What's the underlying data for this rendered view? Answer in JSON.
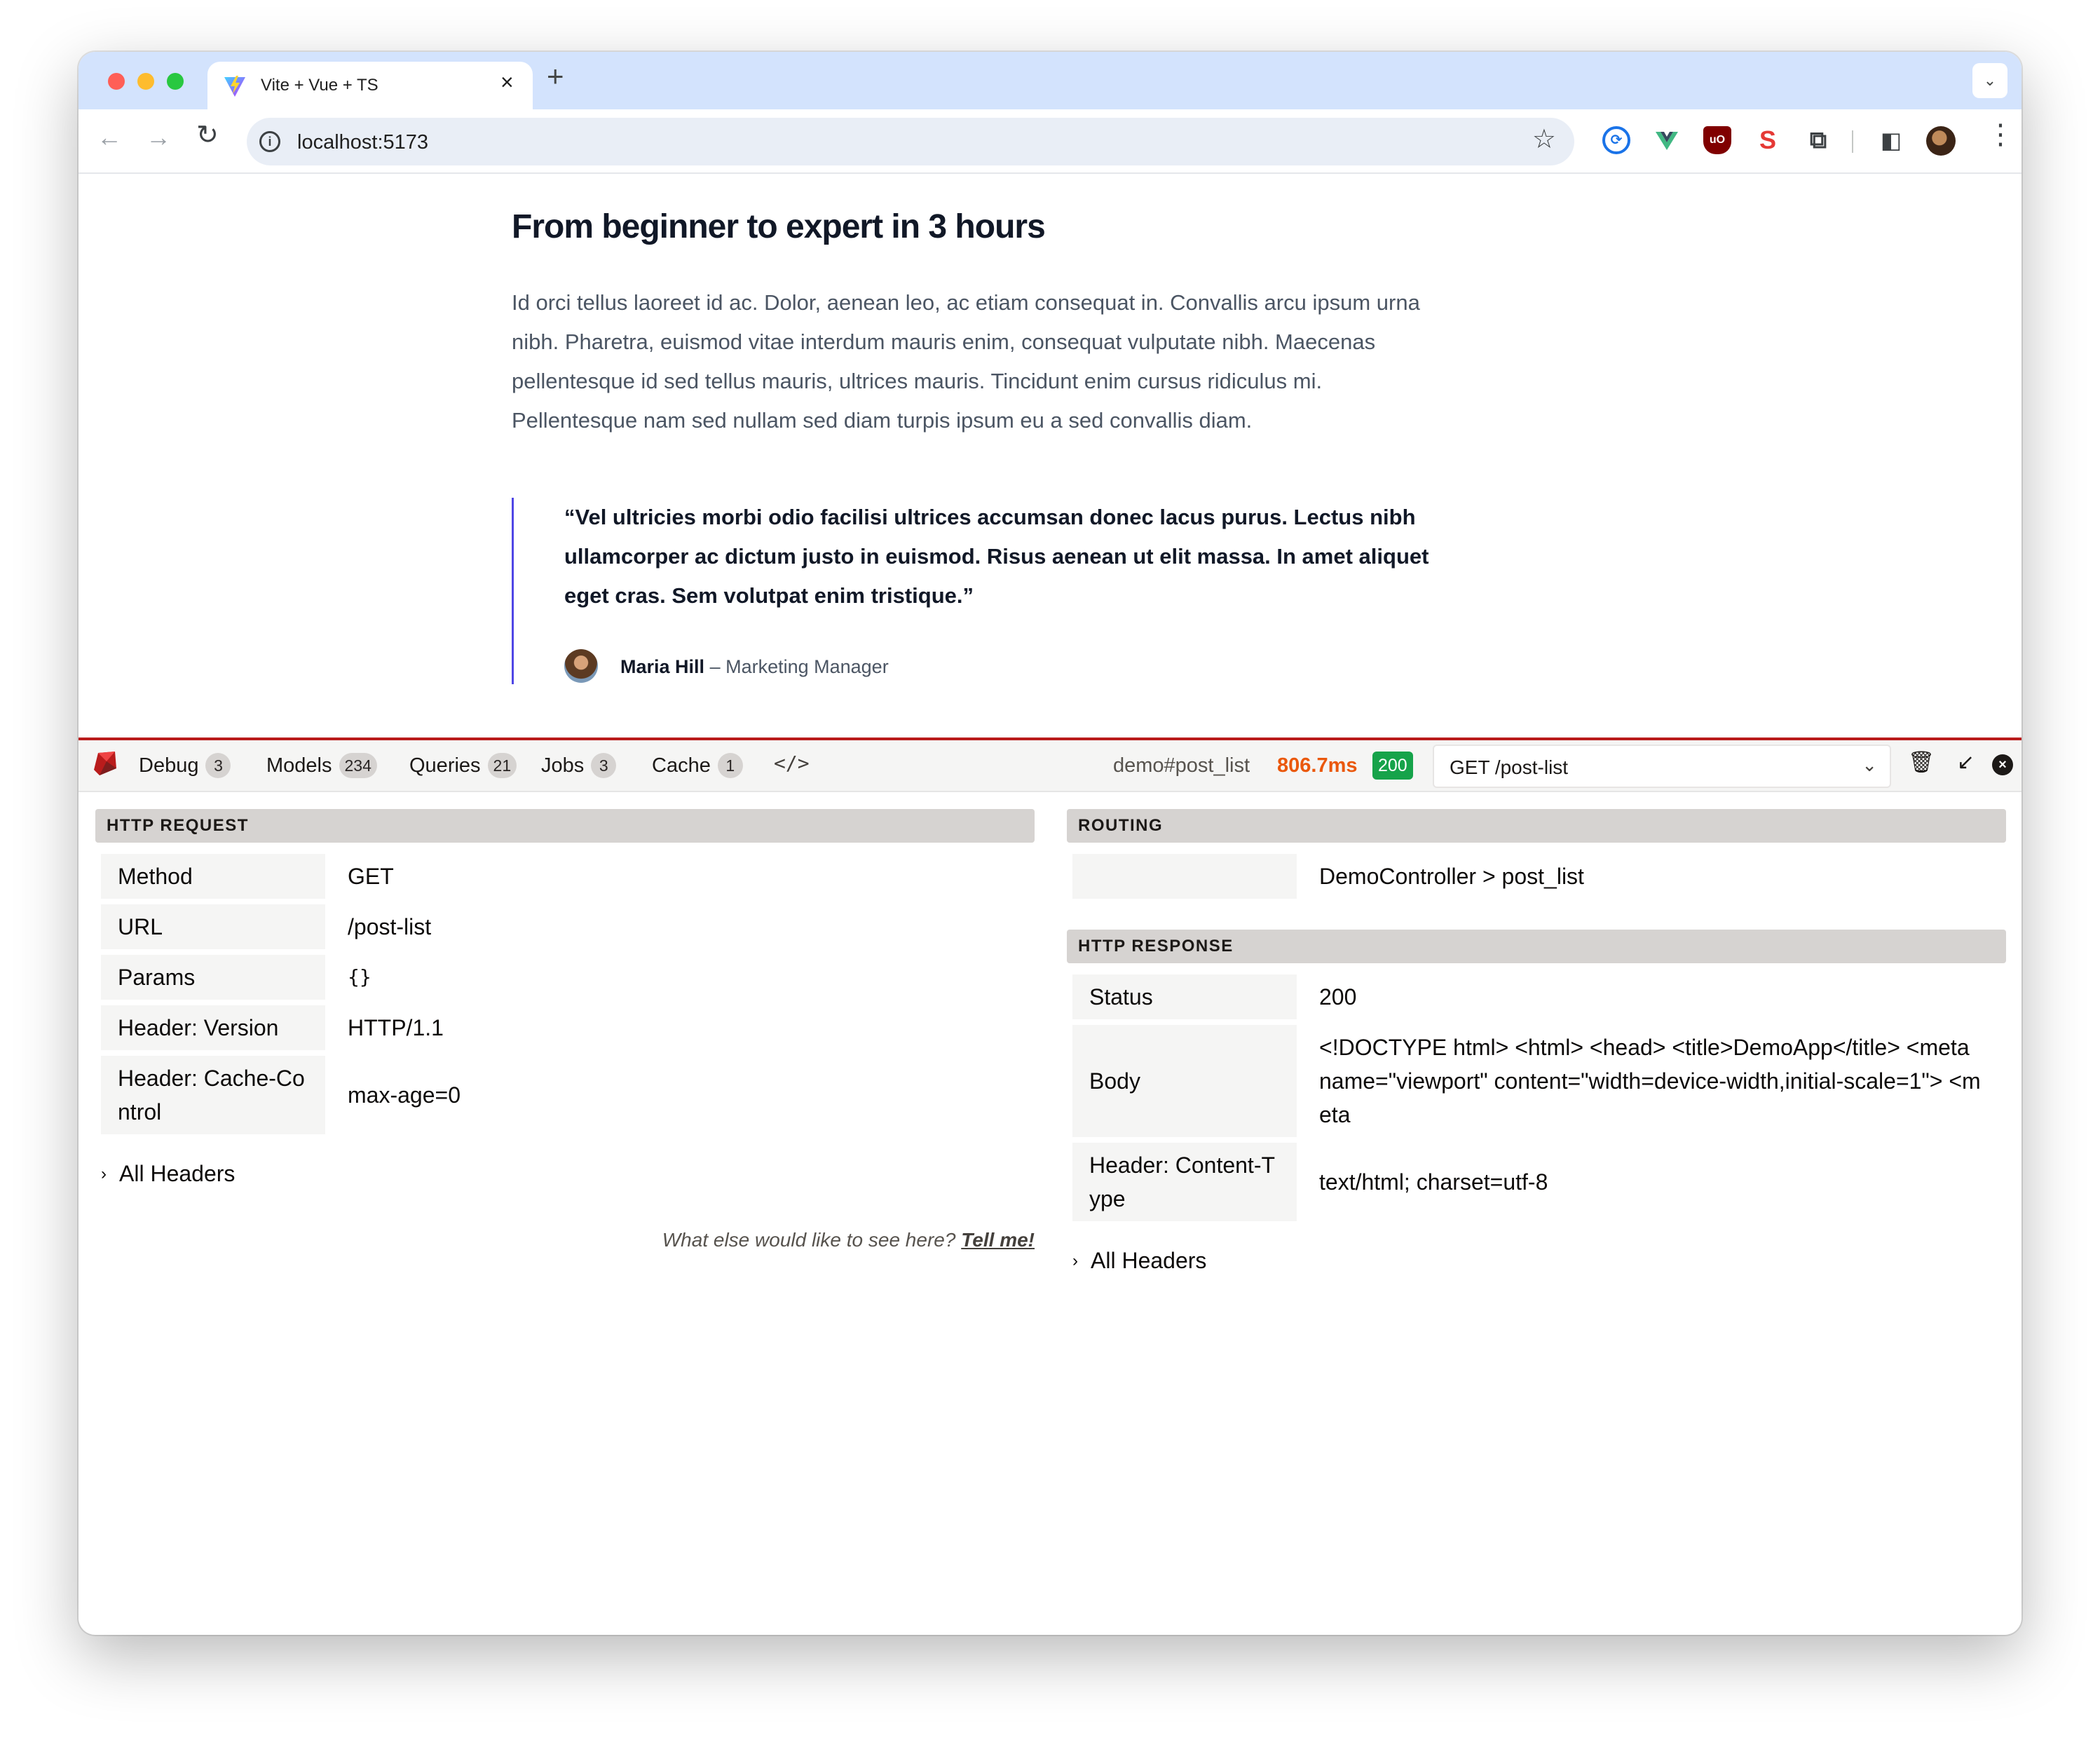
{
  "browser": {
    "tab_title": "Vite + Vue + TS",
    "tab_close": "×",
    "new_tab": "+",
    "tab_menu": "⌄",
    "url": "localhost:5173",
    "nav_back": "←",
    "nav_forward": "→",
    "nav_reload": "↻",
    "info": "i",
    "star": "☆",
    "menu": "⋮",
    "extensions": [
      "password-manager-icon",
      "vue-devtools-icon",
      "ublock-origin-icon",
      "seo-extension-icon",
      "extensions-puzzle-icon",
      "side-panel-icon"
    ]
  },
  "article": {
    "title": "From beginner to expert in 3 hours",
    "body": "Id orci tellus laoreet id ac. Dolor, aenean leo, ac etiam consequat in. Convallis arcu ipsum urna nibh. Pharetra, euismod vitae interdum mauris enim, consequat vulputate nibh. Maecenas pellentesque id sed tellus mauris, ultrices mauris. Tincidunt enim cursus ridiculus mi. Pellentesque nam sed nullam sed diam turpis ipsum eu a sed convallis diam.",
    "quote": "“Vel ultricies morbi odio facilisi ultrices accumsan donec lacus purus. Lectus nibh ullamcorper ac dictum justo in euismod. Risus aenean ut elit massa. In amet aliquet eget cras. Sem volutpat enim tristique.”",
    "author_name": "Maria Hill",
    "author_role": "– Marketing Manager"
  },
  "debugbar": {
    "tabs": [
      {
        "label": "Debug",
        "count": "3"
      },
      {
        "label": "Models",
        "count": "234"
      },
      {
        "label": "Queries",
        "count": "21"
      },
      {
        "label": "Jobs",
        "count": "3"
      },
      {
        "label": "Cache",
        "count": "1"
      }
    ],
    "code_icon": "</>",
    "route": "demo#post_list",
    "duration": "806.7ms",
    "status": "200",
    "request_select": "GET /post-list",
    "select_chevron": "⌄",
    "trash": "🗑",
    "minimize": "↙",
    "close": "×",
    "accent_color": "#b91c1c"
  },
  "http_request": {
    "heading": "HTTP REQUEST",
    "rows": [
      {
        "key": "Method",
        "value": "GET"
      },
      {
        "key": "URL",
        "value": "/post-list"
      },
      {
        "key": "Params",
        "value": "{}"
      },
      {
        "key": "Header: Version",
        "value": "HTTP/1.1"
      },
      {
        "key": "Header: Cache-Control",
        "value": "max-age=0"
      }
    ],
    "all_headers": "All Headers",
    "feedback_text": "What else would like to see here?",
    "feedback_link": "Tell me!"
  },
  "routing": {
    "heading": "ROUTING",
    "rows": [
      {
        "key": "",
        "value": "DemoController > post_list"
      }
    ]
  },
  "http_response": {
    "heading": "HTTP RESPONSE",
    "rows": [
      {
        "key": "Status",
        "value": "200"
      },
      {
        "key": "Body",
        "value": "<!DOCTYPE html> <html> <head> <title>DemoApp</title> <meta name=\"viewport\" content=\"width=device-width,initial-scale=1\"> <meta"
      },
      {
        "key": "Header: Content-Type",
        "value": "text/html; charset=utf-8"
      }
    ],
    "all_headers": "All Headers"
  }
}
